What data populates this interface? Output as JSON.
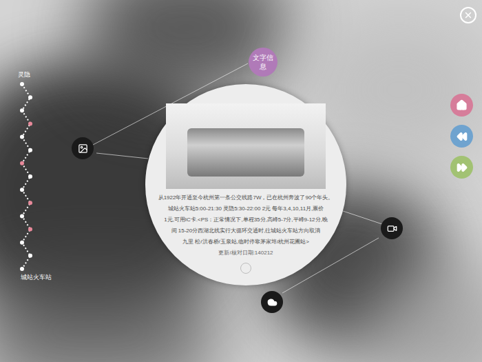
{
  "route": {
    "start": "灵隐",
    "end": "城站火车站",
    "stops": [
      {
        "color": "#ffffff"
      },
      {
        "color": "#ffffff"
      },
      {
        "color": "#ffffff"
      },
      {
        "color": "#e8899a"
      },
      {
        "color": "#ffffff"
      },
      {
        "color": "#ffffff"
      },
      {
        "color": "#e8899a"
      },
      {
        "color": "#ffffff"
      },
      {
        "color": "#ffffff"
      },
      {
        "color": "#e8899a"
      },
      {
        "color": "#ffffff"
      },
      {
        "color": "#e8899a"
      },
      {
        "color": "#ffffff"
      },
      {
        "color": "#ffffff"
      },
      {
        "color": "#ffffff"
      }
    ]
  },
  "text_info_button": "文字信息",
  "info": {
    "lines": [
      "从1922年开通至今杭州第一条公交线路7W，已在杭州奔波了90个年头。",
      "城站火车站5:00-21:30  灵隐5:30-22:00  2元  每年3,4,10,11月,票价",
      "1元,可用IC卡.<PS：正常情况下,单程35分,高峰5-7分,平峰9-12分,晚",
      "间 15-20分西湖北线实行大循环交通时,往城站火车站方向取消",
      "九里 松/洪春桥/玉泉站,临时停靠茅家埠/杭州花圃站>"
    ],
    "updated": "更新/核对日期:140212"
  }
}
